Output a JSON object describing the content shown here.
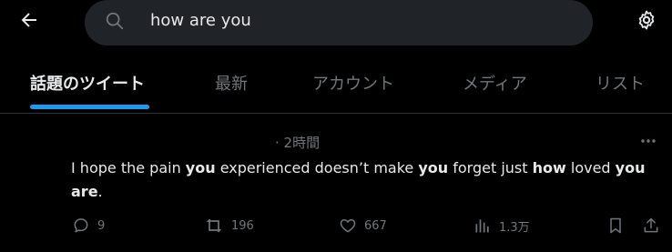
{
  "search": {
    "value": "how are you"
  },
  "tabs": [
    {
      "label": "話題のツイート"
    },
    {
      "label": "最新"
    },
    {
      "label": "アカウント"
    },
    {
      "label": "メディア"
    },
    {
      "label": "リスト"
    }
  ],
  "tweet": {
    "time": "· 2時間",
    "text_parts": [
      "I hope the pain ",
      "you",
      " experienced doesn’t make ",
      "you",
      " forget just ",
      "how",
      " loved ",
      "you",
      "are",
      "."
    ],
    "stats": {
      "replies": "9",
      "retweets": "196",
      "likes": "667",
      "views": "1.3万"
    }
  },
  "colors": {
    "accent": "#1d9bf0",
    "background": "#000000",
    "text": "#e7e9ea",
    "muted": "#71767b",
    "search_bg": "#202327"
  }
}
